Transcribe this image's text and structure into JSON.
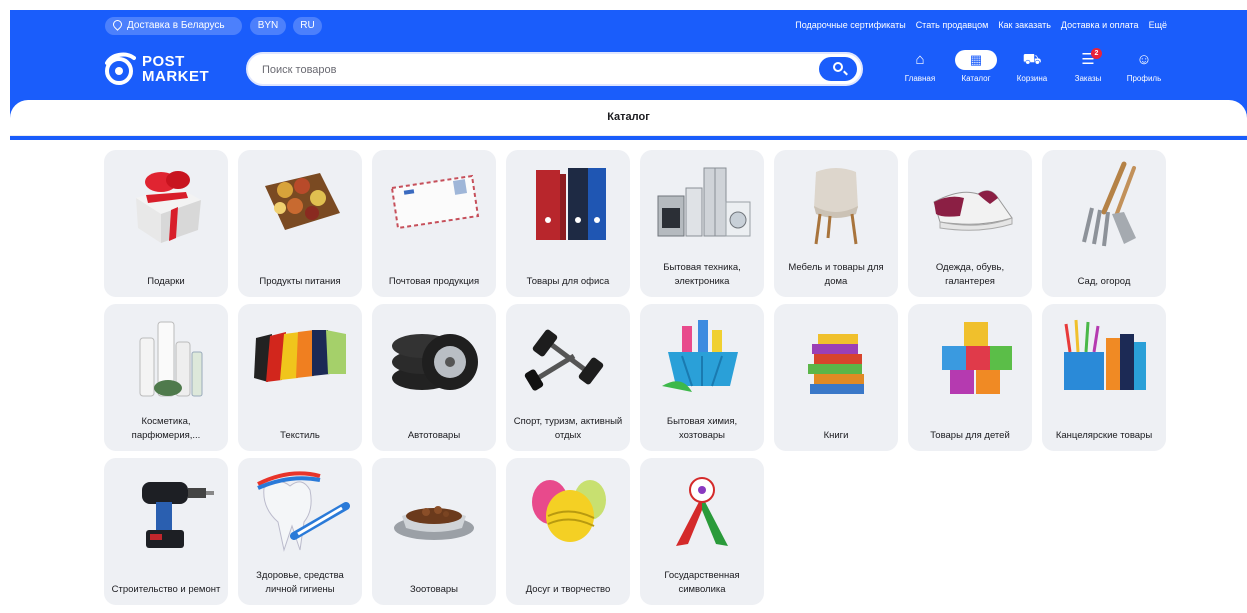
{
  "topbar": {
    "delivery": "Доставка в Беларусь",
    "currency": "BYN",
    "language": "RU",
    "links": [
      "Подарочные сертификаты",
      "Стать продавцом",
      "Как заказать",
      "Доставка и оплата",
      "Ещё"
    ]
  },
  "logo": {
    "line1": "POST",
    "line2": "MARKET"
  },
  "search": {
    "placeholder": "Поиск товаров"
  },
  "nav": [
    {
      "label": "Главная",
      "icon": "home-icon"
    },
    {
      "label": "Каталог",
      "icon": "catalog-icon",
      "active": true
    },
    {
      "label": "Корзина",
      "icon": "cart-icon"
    },
    {
      "label": "Заказы",
      "icon": "orders-icon",
      "badge": "2"
    },
    {
      "label": "Профиль",
      "icon": "profile-icon"
    }
  ],
  "page_title": "Каталог",
  "categories": [
    {
      "label": "Подарки",
      "icon": "gift-icon"
    },
    {
      "label": "Продукты питания",
      "icon": "food-basket-icon"
    },
    {
      "label": "Почтовая продукция",
      "icon": "envelope-icon"
    },
    {
      "label": "Товары для офиса",
      "icon": "binders-icon"
    },
    {
      "label": "Бытовая техника, электроника",
      "icon": "appliances-icon"
    },
    {
      "label": "Мебель и товары для дома",
      "icon": "chair-icon"
    },
    {
      "label": "Одежда, обувь, галантерея",
      "icon": "sneaker-icon"
    },
    {
      "label": "Сад, огород",
      "icon": "garden-tools-icon"
    },
    {
      "label": "Косметика, парфюмерия,...",
      "icon": "cosmetics-icon"
    },
    {
      "label": "Текстиль",
      "icon": "textile-icon"
    },
    {
      "label": "Автотовары",
      "icon": "tires-icon"
    },
    {
      "label": "Спорт, туризм, активный отдых",
      "icon": "dumbbells-icon"
    },
    {
      "label": "Бытовая химия, хозтовары",
      "icon": "cleaning-icon"
    },
    {
      "label": "Книги",
      "icon": "books-icon"
    },
    {
      "label": "Товары для детей",
      "icon": "toy-blocks-icon"
    },
    {
      "label": "Канцелярские товары",
      "icon": "stationery-icon"
    },
    {
      "label": "Строительство и ремонт",
      "icon": "drill-icon"
    },
    {
      "label": "Здоровье, средства личной гигиены",
      "icon": "tooth-icon"
    },
    {
      "label": "Зоотовары",
      "icon": "pet-bowl-icon"
    },
    {
      "label": "Досуг и творчество",
      "icon": "yarn-icon"
    },
    {
      "label": "Государственная символика",
      "icon": "ribbon-icon"
    }
  ],
  "colors": {
    "brand": "#1a5dfb",
    "card": "#eef0f4",
    "badge": "#e8243a"
  }
}
